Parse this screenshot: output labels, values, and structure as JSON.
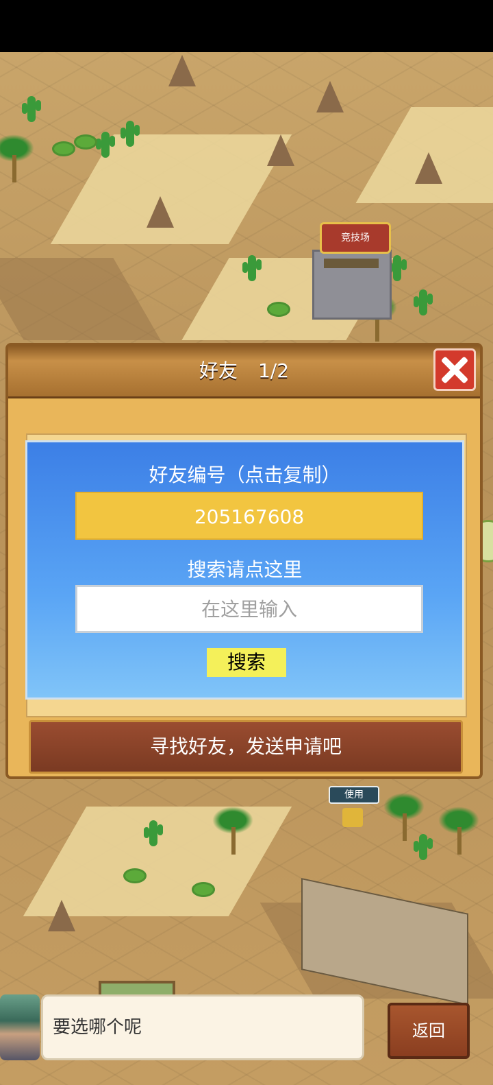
{
  "arena_sign": "竞技场",
  "use_tag": "使用",
  "panel": {
    "title": "好友",
    "page_indicator": "1/2",
    "find_friends_button": "寻找好友，发送申请吧"
  },
  "dialog": {
    "friend_id_label": "好友编号（点击复制）",
    "friend_id": "205167608",
    "search_label": "搜索请点这里",
    "search_placeholder": "在这里输入",
    "search_button": "搜索"
  },
  "bottom": {
    "speech_text": "要选哪个呢",
    "back_button": "返回"
  },
  "colors": {
    "dialog_blue": "#3c7fe6",
    "id_box_yellow": "#f2c540",
    "search_button_yellow": "#f4f05a",
    "panel_tan": "#e9b65a",
    "close_red": "#d33a2c"
  }
}
